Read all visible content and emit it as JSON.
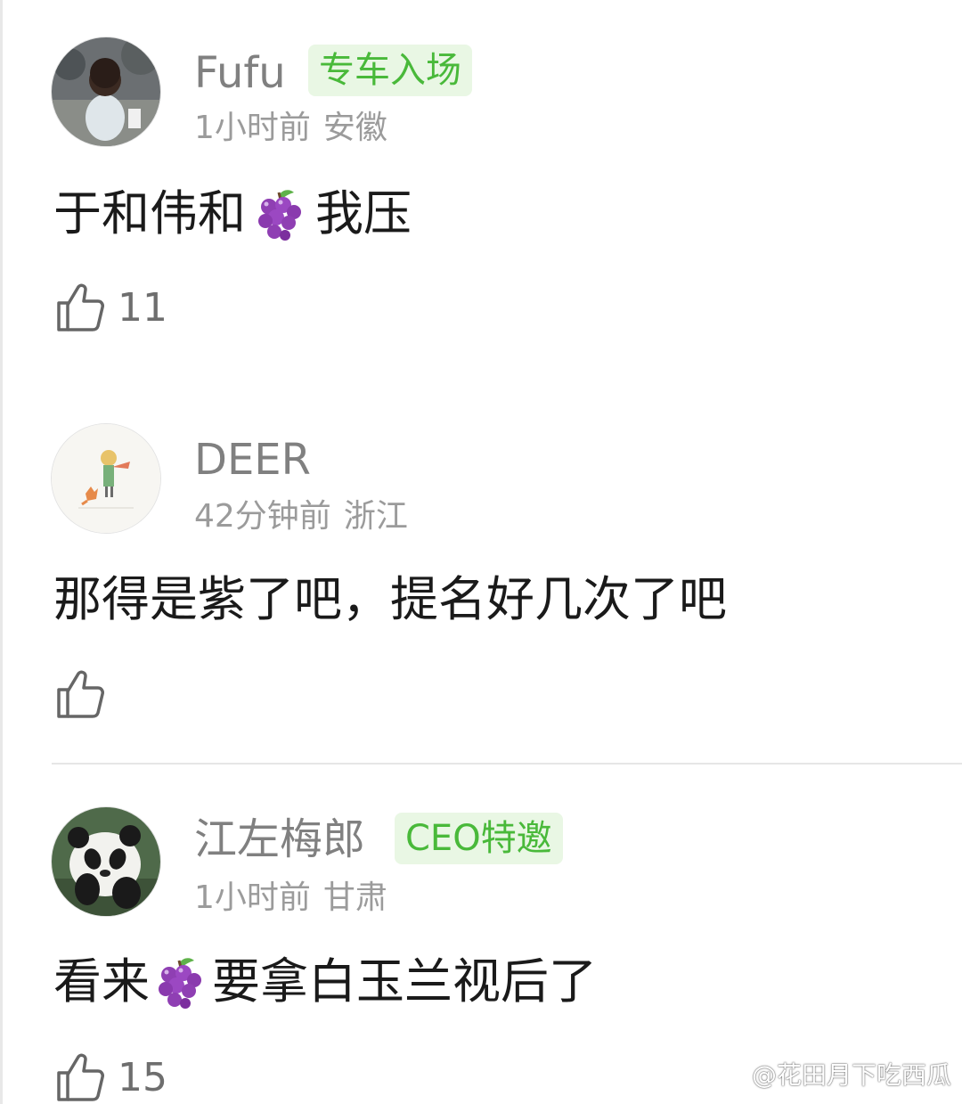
{
  "colors": {
    "badge_text": "#49b93a",
    "badge_bg": "#e9f7e4",
    "username": "#808080",
    "meta": "#9b9b9b",
    "body": "#1a1a1a"
  },
  "comments": [
    {
      "username": "Fufu",
      "badge": "专车入场",
      "time": "1小时前",
      "location": "安徽",
      "text_before": "于和伟和",
      "emoji": "grape-emoji",
      "text_after": " 我压",
      "likes": "11",
      "like_icon": "thumbs-up-icon"
    },
    {
      "username": "DEER",
      "badge": "",
      "time": "42分钟前",
      "location": "浙江",
      "text": "那得是紫了吧，提名好几次了吧",
      "likes": "",
      "like_icon": "thumbs-up-icon"
    },
    {
      "username": "江左梅郎",
      "badge": "CEO特邀",
      "time": "1小时前",
      "location": "甘肃",
      "text_before": "看来",
      "emoji": "grape-emoji",
      "text_after": "要拿白玉兰视后了",
      "likes": "15",
      "like_icon": "thumbs-up-icon"
    }
  ],
  "watermark": "@花田月下吃西瓜"
}
